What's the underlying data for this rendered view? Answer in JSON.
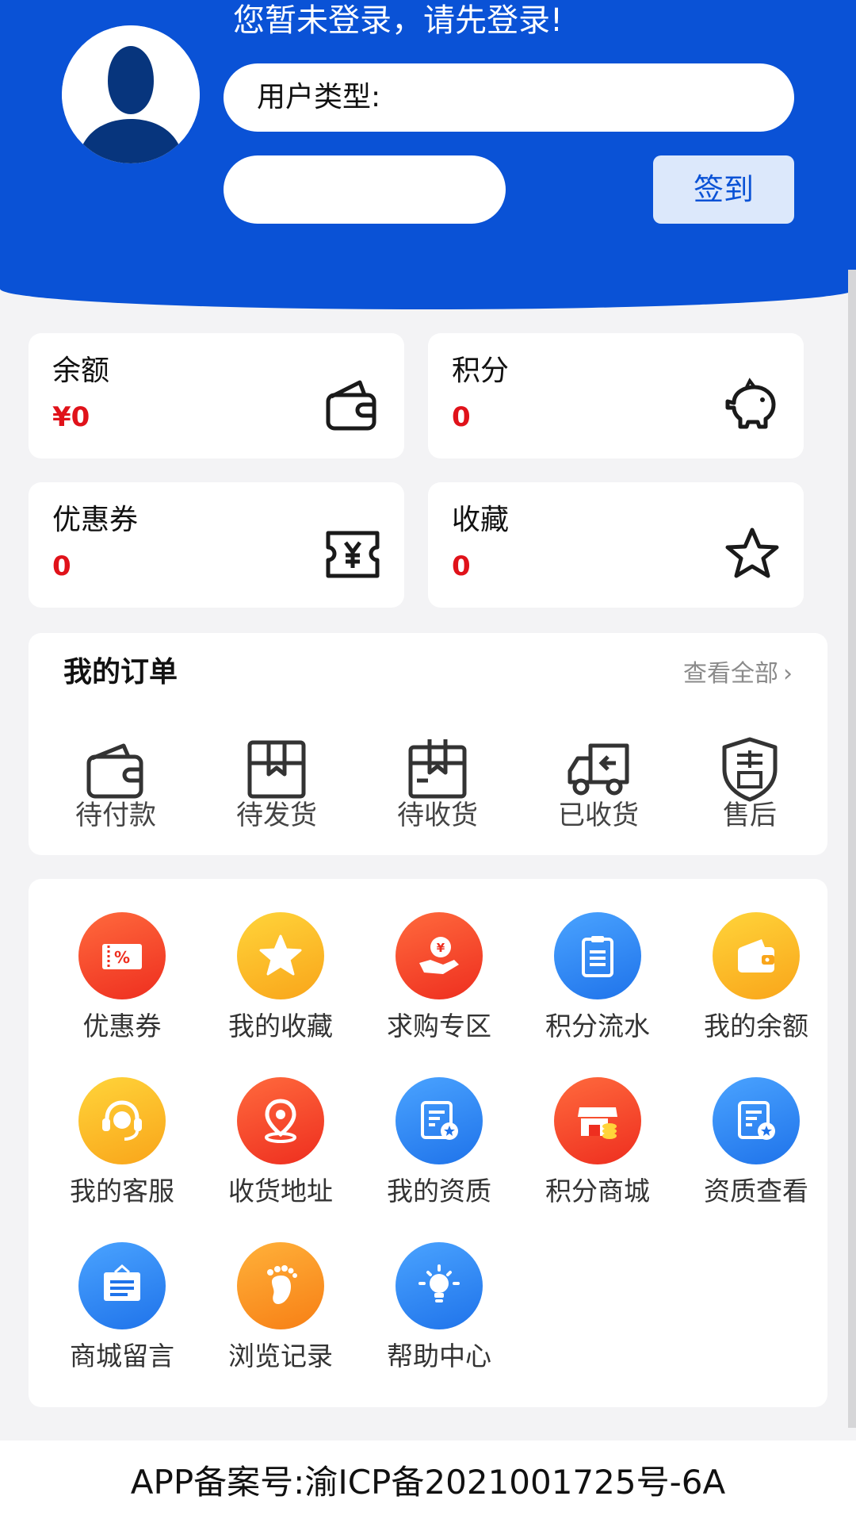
{
  "header": {
    "login_prompt": "您暂未登录，请先登录!",
    "user_type_label": "用户类型:",
    "checkin_label": "签到"
  },
  "stats": [
    {
      "label": "余额",
      "value": "¥0",
      "icon": "wallet-icon"
    },
    {
      "label": "积分",
      "value": "0",
      "icon": "piggy-bank-icon"
    },
    {
      "label": "优惠券",
      "value": "0",
      "icon": "yen-ticket-icon"
    },
    {
      "label": "收藏",
      "value": "0",
      "icon": "star-icon"
    }
  ],
  "orders": {
    "title": "我的订单",
    "view_all": "查看全部",
    "items": [
      {
        "label": "待付款",
        "icon": "wallet-icon"
      },
      {
        "label": "待发货",
        "icon": "box-icon"
      },
      {
        "label": "待收货",
        "icon": "package-icon"
      },
      {
        "label": "已收货",
        "icon": "truck-icon"
      },
      {
        "label": "售后",
        "icon": "shield-icon"
      }
    ]
  },
  "services": [
    {
      "label": "优惠券",
      "icon": "coupon-icon",
      "color": "#ee2e1f"
    },
    {
      "label": "我的收藏",
      "icon": "star-icon",
      "color": "#f9a51a"
    },
    {
      "label": "求购专区",
      "icon": "hand-coin-icon",
      "color": "#ee2e1f"
    },
    {
      "label": "积分流水",
      "icon": "clipboard-icon",
      "color": "#1f73ea"
    },
    {
      "label": "我的余额",
      "icon": "wallet-icon",
      "color": "#f9a51a"
    },
    {
      "label": "我的客服",
      "icon": "headset-icon",
      "color": "#f9a51a"
    },
    {
      "label": "收货地址",
      "icon": "location-pin-icon",
      "color": "#ee2e1f"
    },
    {
      "label": "我的资质",
      "icon": "certificate-icon",
      "color": "#1f73ea"
    },
    {
      "label": "积分商城",
      "icon": "store-icon",
      "color": "#ee2e1f"
    },
    {
      "label": "资质查看",
      "icon": "certificate-icon",
      "color": "#1f73ea"
    },
    {
      "label": "商城留言",
      "icon": "message-board-icon",
      "color": "#1f73ea"
    },
    {
      "label": "浏览记录",
      "icon": "footprint-icon",
      "color": "#f77f15"
    },
    {
      "label": "帮助中心",
      "icon": "lightbulb-icon",
      "color": "#1f73ea"
    }
  ],
  "footer": {
    "icp": "APP备案号:渝ICP备2021001725号-6A"
  }
}
